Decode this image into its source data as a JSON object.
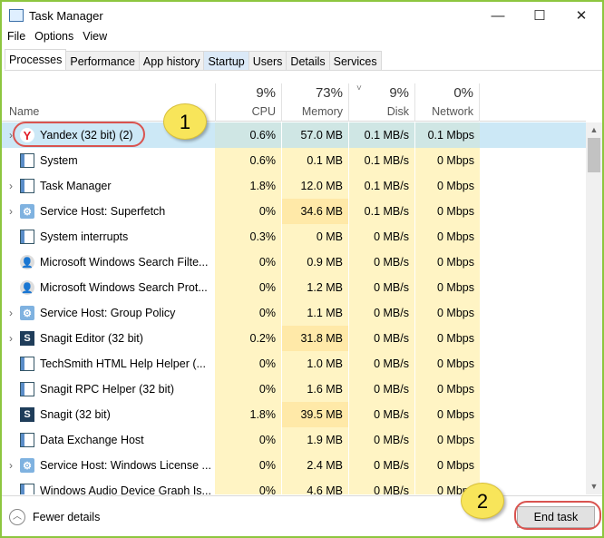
{
  "window": {
    "title": "Task Manager",
    "minimize": "—",
    "maximize": "☐",
    "close": "✕"
  },
  "menu": [
    "File",
    "Options",
    "View"
  ],
  "tabs": [
    "Processes",
    "Performance",
    "App history",
    "Startup",
    "Users",
    "Details",
    "Services"
  ],
  "header": {
    "name": "Name",
    "cpu_pct": "9%",
    "cpu": "CPU",
    "mem_pct": "73%",
    "mem": "Memory",
    "disk_pct": "9%",
    "disk": "Disk",
    "net_pct": "0%",
    "net": "Network",
    "sort": "˅"
  },
  "rows": [
    {
      "name": "Yandex (32 bit) (2)",
      "cpu": "0.6%",
      "mem": "57.0 MB",
      "disk": "0.1 MB/s",
      "net": "0.1 Mbps"
    },
    {
      "name": "System",
      "cpu": "0.6%",
      "mem": "0.1 MB",
      "disk": "0.1 MB/s",
      "net": "0 Mbps"
    },
    {
      "name": "Task Manager",
      "cpu": "1.8%",
      "mem": "12.0 MB",
      "disk": "0.1 MB/s",
      "net": "0 Mbps"
    },
    {
      "name": "Service Host: Superfetch",
      "cpu": "0%",
      "mem": "34.6 MB",
      "disk": "0.1 MB/s",
      "net": "0 Mbps"
    },
    {
      "name": "System interrupts",
      "cpu": "0.3%",
      "mem": "0 MB",
      "disk": "0 MB/s",
      "net": "0 Mbps"
    },
    {
      "name": "Microsoft Windows Search Filte...",
      "cpu": "0%",
      "mem": "0.9 MB",
      "disk": "0 MB/s",
      "net": "0 Mbps"
    },
    {
      "name": "Microsoft Windows Search Prot...",
      "cpu": "0%",
      "mem": "1.2 MB",
      "disk": "0 MB/s",
      "net": "0 Mbps"
    },
    {
      "name": "Service Host: Group Policy",
      "cpu": "0%",
      "mem": "1.1 MB",
      "disk": "0 MB/s",
      "net": "0 Mbps"
    },
    {
      "name": "Snagit Editor (32 bit)",
      "cpu": "0.2%",
      "mem": "31.8 MB",
      "disk": "0 MB/s",
      "net": "0 Mbps"
    },
    {
      "name": "TechSmith HTML Help Helper (...",
      "cpu": "0%",
      "mem": "1.0 MB",
      "disk": "0 MB/s",
      "net": "0 Mbps"
    },
    {
      "name": "Snagit RPC Helper (32 bit)",
      "cpu": "0%",
      "mem": "1.6 MB",
      "disk": "0 MB/s",
      "net": "0 Mbps"
    },
    {
      "name": "Snagit (32 bit)",
      "cpu": "1.8%",
      "mem": "39.5 MB",
      "disk": "0 MB/s",
      "net": "0 Mbps"
    },
    {
      "name": "Data Exchange Host",
      "cpu": "0%",
      "mem": "1.9 MB",
      "disk": "0 MB/s",
      "net": "0 Mbps"
    },
    {
      "name": "Service Host: Windows License ...",
      "cpu": "0%",
      "mem": "2.4 MB",
      "disk": "0 MB/s",
      "net": "0 Mbps"
    },
    {
      "name": "Windows Audio Device Graph Is...",
      "cpu": "0%",
      "mem": "4.6 MB",
      "disk": "0 MB/s",
      "net": "0 Mbps"
    }
  ],
  "footer": {
    "fewer": "Fewer details",
    "end_task": "End task"
  },
  "callouts": {
    "one": "1",
    "two": "2"
  }
}
